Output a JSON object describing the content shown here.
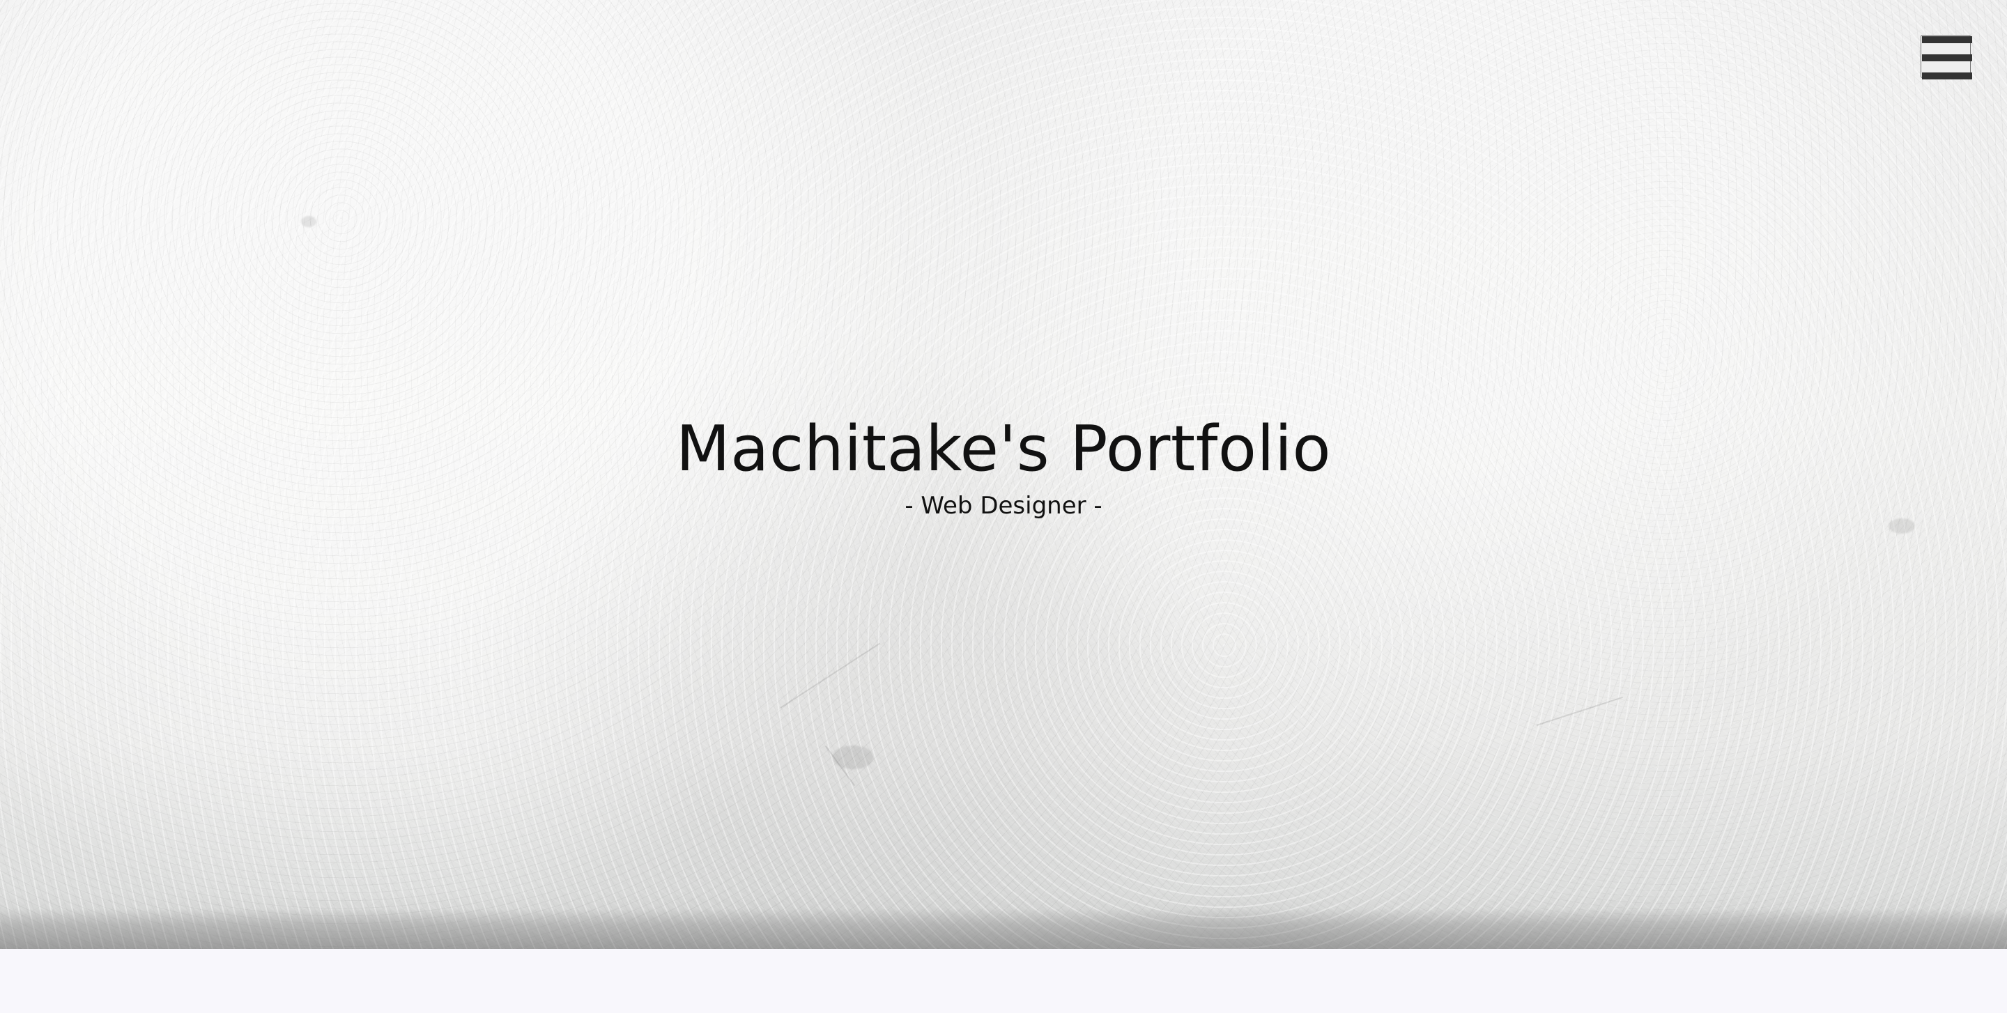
{
  "hero": {
    "title": "Machitake's Portfolio",
    "subtitle": "- Web Designer -",
    "background_icon": "textured-wall-image"
  },
  "navigation": {
    "menu_icon": "hamburger-menu-icon",
    "menu_color": "#333333"
  },
  "colors": {
    "text": "#111111",
    "page_background": "#f8f7fc"
  }
}
